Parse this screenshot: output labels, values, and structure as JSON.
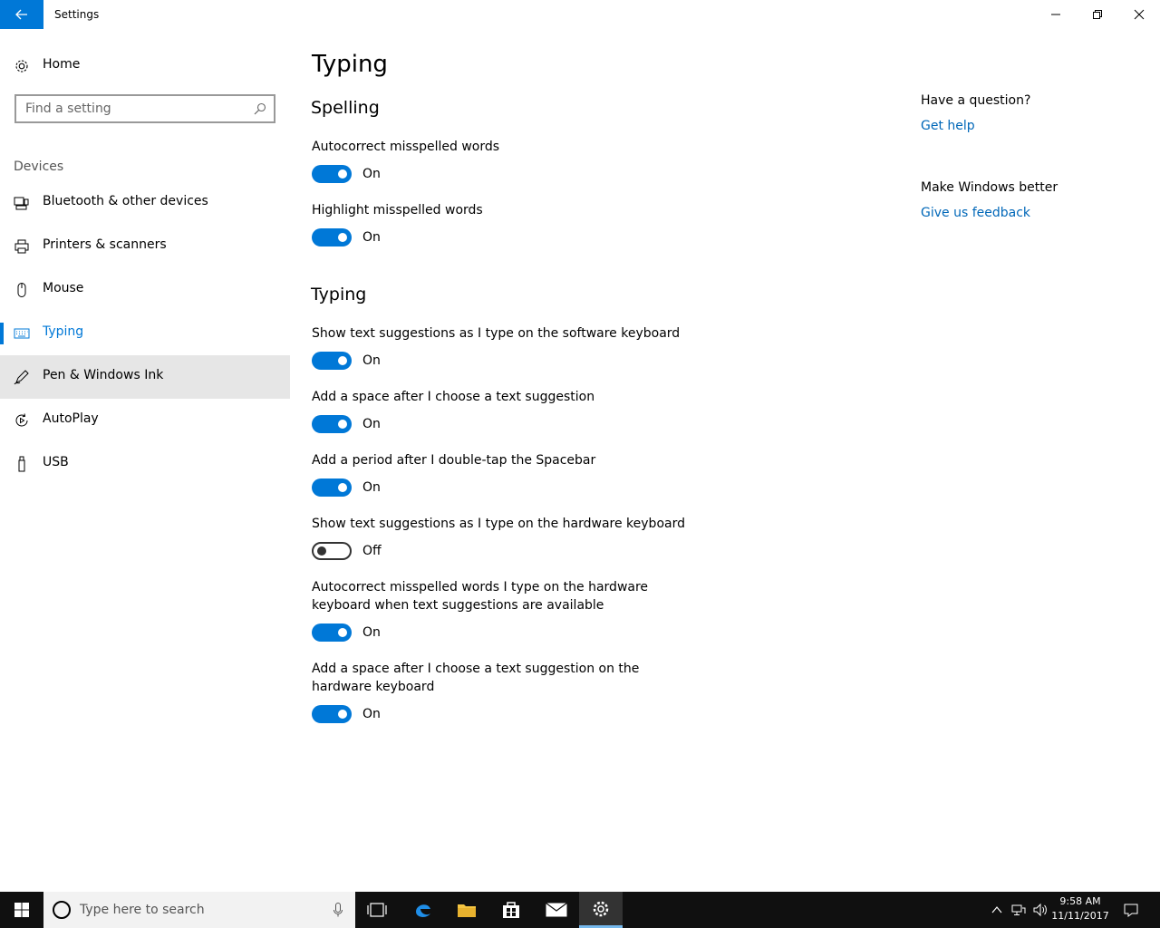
{
  "window": {
    "title": "Settings"
  },
  "nav": {
    "home_label": "Home",
    "search_placeholder": "Find a setting",
    "group_title": "Devices",
    "items": [
      {
        "label": "Bluetooth & other devices",
        "icon": "bluetooth-devices-icon"
      },
      {
        "label": "Printers & scanners",
        "icon": "printer-icon"
      },
      {
        "label": "Mouse",
        "icon": "mouse-icon"
      },
      {
        "label": "Typing",
        "icon": "keyboard-icon",
        "active": true
      },
      {
        "label": "Pen & Windows Ink",
        "icon": "pen-icon",
        "hover": true
      },
      {
        "label": "AutoPlay",
        "icon": "autoplay-icon"
      },
      {
        "label": "USB",
        "icon": "usb-icon"
      }
    ]
  },
  "content": {
    "page_title": "Typing",
    "sections": [
      {
        "title": "Spelling",
        "settings": [
          {
            "label": "Autocorrect misspelled words",
            "state": "On"
          },
          {
            "label": "Highlight misspelled words",
            "state": "On"
          }
        ]
      },
      {
        "title": "Typing",
        "settings": [
          {
            "label": "Show text suggestions as I type on the software keyboard",
            "state": "On"
          },
          {
            "label": "Add a space after I choose a text suggestion",
            "state": "On"
          },
          {
            "label": "Add a period after I double-tap the Spacebar",
            "state": "On"
          },
          {
            "label": "Show text suggestions as I type on the hardware keyboard",
            "state": "Off"
          },
          {
            "label": "Autocorrect misspelled words I type on the hardware keyboard when text suggestions are available",
            "state": "On"
          },
          {
            "label": "Add a space after I choose a text suggestion on the hardware keyboard",
            "state": "On"
          }
        ]
      }
    ]
  },
  "aside": {
    "question_title": "Have a question?",
    "help_link": "Get help",
    "feedback_title": "Make Windows better",
    "feedback_link": "Give us feedback"
  },
  "taskbar": {
    "search_placeholder": "Type here to search",
    "time": "9:58 AM",
    "date": "11/11/2017"
  },
  "colors": {
    "accent": "#0078d7",
    "link": "#0067b8",
    "taskbar": "#101010"
  }
}
